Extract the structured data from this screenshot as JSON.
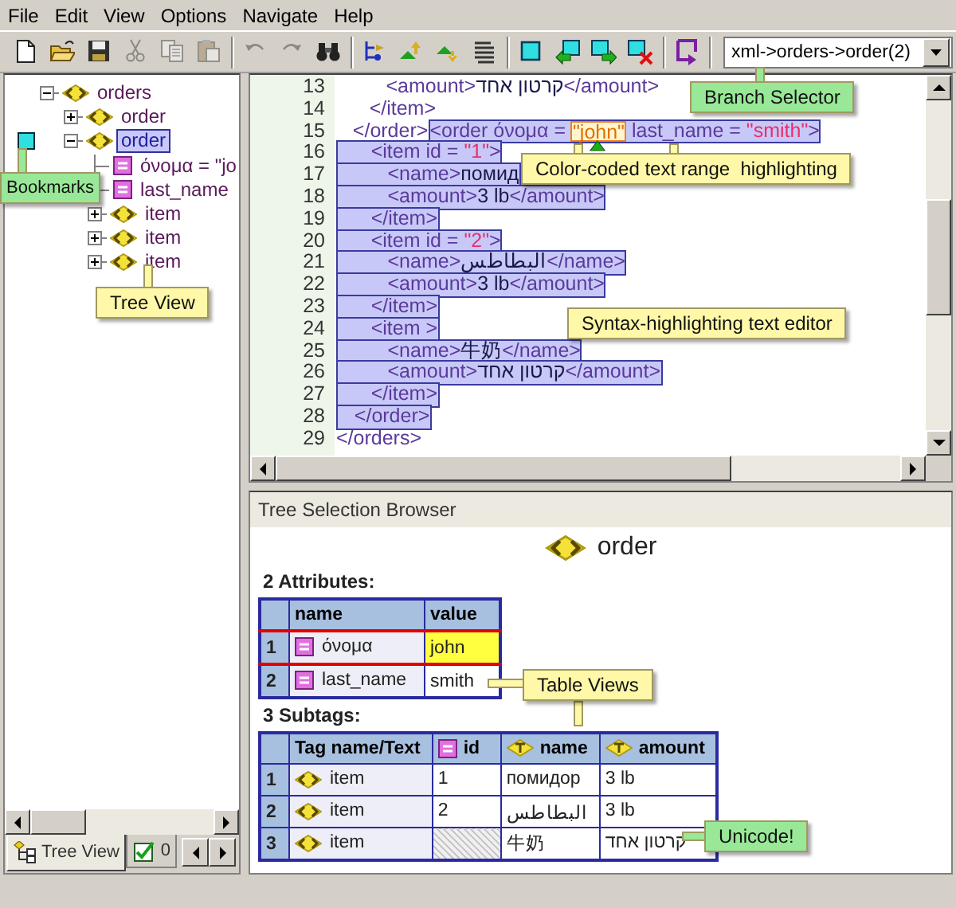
{
  "menu": [
    "File",
    "Edit",
    "View",
    "Options",
    "Navigate",
    "Help"
  ],
  "toolbar": [
    [
      {
        "kind": "new",
        "disabled": false
      },
      {
        "kind": "open",
        "disabled": false
      },
      {
        "kind": "save",
        "disabled": false
      },
      {
        "kind": "cut",
        "disabled": true
      },
      {
        "kind": "copy",
        "disabled": true
      },
      {
        "kind": "paste",
        "disabled": true
      }
    ],
    [
      {
        "kind": "undo",
        "disabled": true
      },
      {
        "kind": "redo",
        "disabled": true
      },
      {
        "kind": "find",
        "disabled": false
      }
    ],
    [
      {
        "kind": "tree",
        "disabled": false
      },
      {
        "kind": "up",
        "disabled": false
      },
      {
        "kind": "down",
        "disabled": false
      },
      {
        "kind": "list",
        "disabled": false
      }
    ],
    [
      {
        "kind": "bookmark",
        "disabled": false
      },
      {
        "kind": "bookmark-prev",
        "disabled": false
      },
      {
        "kind": "bookmark-next",
        "disabled": false
      },
      {
        "kind": "bookmark-clear",
        "disabled": false
      }
    ],
    [
      {
        "kind": "jump",
        "disabled": false
      }
    ]
  ],
  "branch_selector": {
    "value": "xml->orders->order(2)"
  },
  "tree": {
    "items": [
      {
        "label": "orders",
        "kind": "element",
        "expanded": true,
        "selected": false,
        "bookmarked": false,
        "children": [
          {
            "label": "order",
            "kind": "element",
            "expanded": false,
            "selected": false,
            "bookmarked": false
          },
          {
            "label": "order",
            "kind": "element",
            "expanded": true,
            "selected": true,
            "bookmarked": true,
            "children": [
              {
                "label": "όνομα = \"jo",
                "kind": "attribute",
                "selected": false,
                "bookmarked": false
              },
              {
                "label": "last_name",
                "kind": "attribute",
                "selected": false,
                "bookmarked": false
              },
              {
                "label": "item",
                "kind": "element",
                "expanded": false,
                "selected": false,
                "bookmarked": false
              },
              {
                "label": "item",
                "kind": "element",
                "expanded": false,
                "selected": false,
                "bookmarked": false
              },
              {
                "label": "item",
                "kind": "element",
                "expanded": false,
                "selected": false,
                "bookmarked": false
              }
            ]
          }
        ]
      }
    ]
  },
  "tabs": [
    {
      "label": "Tree View",
      "kind": "tree",
      "selected": true
    },
    {
      "label": "0",
      "kind": "check",
      "selected": false
    }
  ],
  "editor": {
    "lines": [
      {
        "num": "13",
        "tokens": [
          {
            "kind": "tag",
            "text": "         <amount>"
          },
          {
            "kind": "text",
            "text": "קרטון אחד"
          },
          {
            "kind": "tag",
            "text": "</amount>"
          }
        ]
      },
      {
        "num": "14",
        "tokens": [
          {
            "kind": "tag",
            "text": "      </item>"
          }
        ]
      },
      {
        "num": "15",
        "tokens": [
          {
            "kind": "tag",
            "text": "   </order>"
          }
        ],
        "range": [
          {
            "kind": "tag",
            "text": "<order όνομα = "
          },
          {
            "kind": "focus",
            "text": "\"john\""
          },
          {
            "kind": "tag",
            "text": " last_name = "
          },
          {
            "kind": "value",
            "text": "\"smith\""
          },
          {
            "kind": "tag",
            "text": ">"
          }
        ]
      },
      {
        "num": "16",
        "range": [
          {
            "kind": "tag",
            "text": "      <item id = "
          },
          {
            "kind": "value",
            "text": "\"1\""
          },
          {
            "kind": "tag",
            "text": ">"
          }
        ]
      },
      {
        "num": "17",
        "range": [
          {
            "kind": "tag",
            "text": "         <name>"
          },
          {
            "kind": "text",
            "text": "помид"
          }
        ]
      },
      {
        "num": "18",
        "range": [
          {
            "kind": "tag",
            "text": "         <amount>"
          },
          {
            "kind": "text",
            "text": "3 lb"
          },
          {
            "kind": "tag",
            "text": "</amount>"
          }
        ]
      },
      {
        "num": "19",
        "range": [
          {
            "kind": "tag",
            "text": "      </item>"
          }
        ]
      },
      {
        "num": "20",
        "range": [
          {
            "kind": "tag",
            "text": "      <item id = "
          },
          {
            "kind": "value",
            "text": "\"2\""
          },
          {
            "kind": "tag",
            "text": ">"
          }
        ]
      },
      {
        "num": "21",
        "range": [
          {
            "kind": "tag",
            "text": "         <name>"
          },
          {
            "kind": "text",
            "text": "البطاطس"
          },
          {
            "kind": "tag",
            "text": "</name>"
          }
        ]
      },
      {
        "num": "22",
        "range": [
          {
            "kind": "tag",
            "text": "         <amount>"
          },
          {
            "kind": "text",
            "text": "3 lb"
          },
          {
            "kind": "tag",
            "text": "</amount>"
          }
        ]
      },
      {
        "num": "23",
        "range": [
          {
            "kind": "tag",
            "text": "      </item>"
          }
        ]
      },
      {
        "num": "24",
        "range": [
          {
            "kind": "tag",
            "text": "      <item >"
          }
        ]
      },
      {
        "num": "25",
        "range": [
          {
            "kind": "tag",
            "text": "         <name>"
          },
          {
            "kind": "text",
            "text": "牛奶"
          },
          {
            "kind": "tag",
            "text": "</name>"
          }
        ]
      },
      {
        "num": "26",
        "range": [
          {
            "kind": "tag",
            "text": "         <amount>"
          },
          {
            "kind": "text",
            "text": "קרטון אחד"
          },
          {
            "kind": "tag",
            "text": "</amount>"
          }
        ]
      },
      {
        "num": "27",
        "range": [
          {
            "kind": "tag",
            "text": "      </item>"
          }
        ]
      },
      {
        "num": "28",
        "range": [
          {
            "kind": "tag",
            "text": "   </order>"
          }
        ]
      },
      {
        "num": "29",
        "tokens": [
          {
            "kind": "tag",
            "text": "</orders>"
          }
        ]
      }
    ]
  },
  "browser": {
    "title": "Tree Selection Browser",
    "node": "order",
    "attributes": {
      "heading": "2 Attributes:",
      "columns": [
        "name",
        "value"
      ],
      "rows": [
        {
          "num": "1",
          "name": "όνομα",
          "value": "john",
          "selected": true
        },
        {
          "num": "2",
          "name": "last_name",
          "value": "smith",
          "selected": false
        }
      ]
    },
    "subtags": {
      "heading": "3 Subtags:",
      "columns": [
        {
          "label": "Tag name/Text",
          "kind": "plain"
        },
        {
          "label": "id",
          "kind": "attribute"
        },
        {
          "label": "name",
          "kind": "text"
        },
        {
          "label": "amount",
          "kind": "text"
        }
      ],
      "rows": [
        {
          "num": "1",
          "cells": [
            "item",
            "1",
            "помидор",
            "3 lb"
          ]
        },
        {
          "num": "2",
          "cells": [
            "item",
            "2",
            "البطاطس",
            "3 lb"
          ]
        },
        {
          "num": "3",
          "cells": [
            "item",
            null,
            "牛奶",
            "קרטון אחד"
          ]
        }
      ]
    }
  },
  "callouts": [
    {
      "text": "Branch Selector",
      "color": "#98e898"
    },
    {
      "text": "Color-coded text range  highlighting",
      "color": "#fff8a8"
    },
    {
      "text": "Bookmarks",
      "color": "#98e898"
    },
    {
      "text": "Tree View",
      "color": "#fff8a8"
    },
    {
      "text": "Syntax-highlighting text editor",
      "color": "#fff8a8"
    },
    {
      "text": "Table Views",
      "color": "#fff8a8"
    },
    {
      "text": "Unicode!",
      "color": "#98e898"
    }
  ]
}
